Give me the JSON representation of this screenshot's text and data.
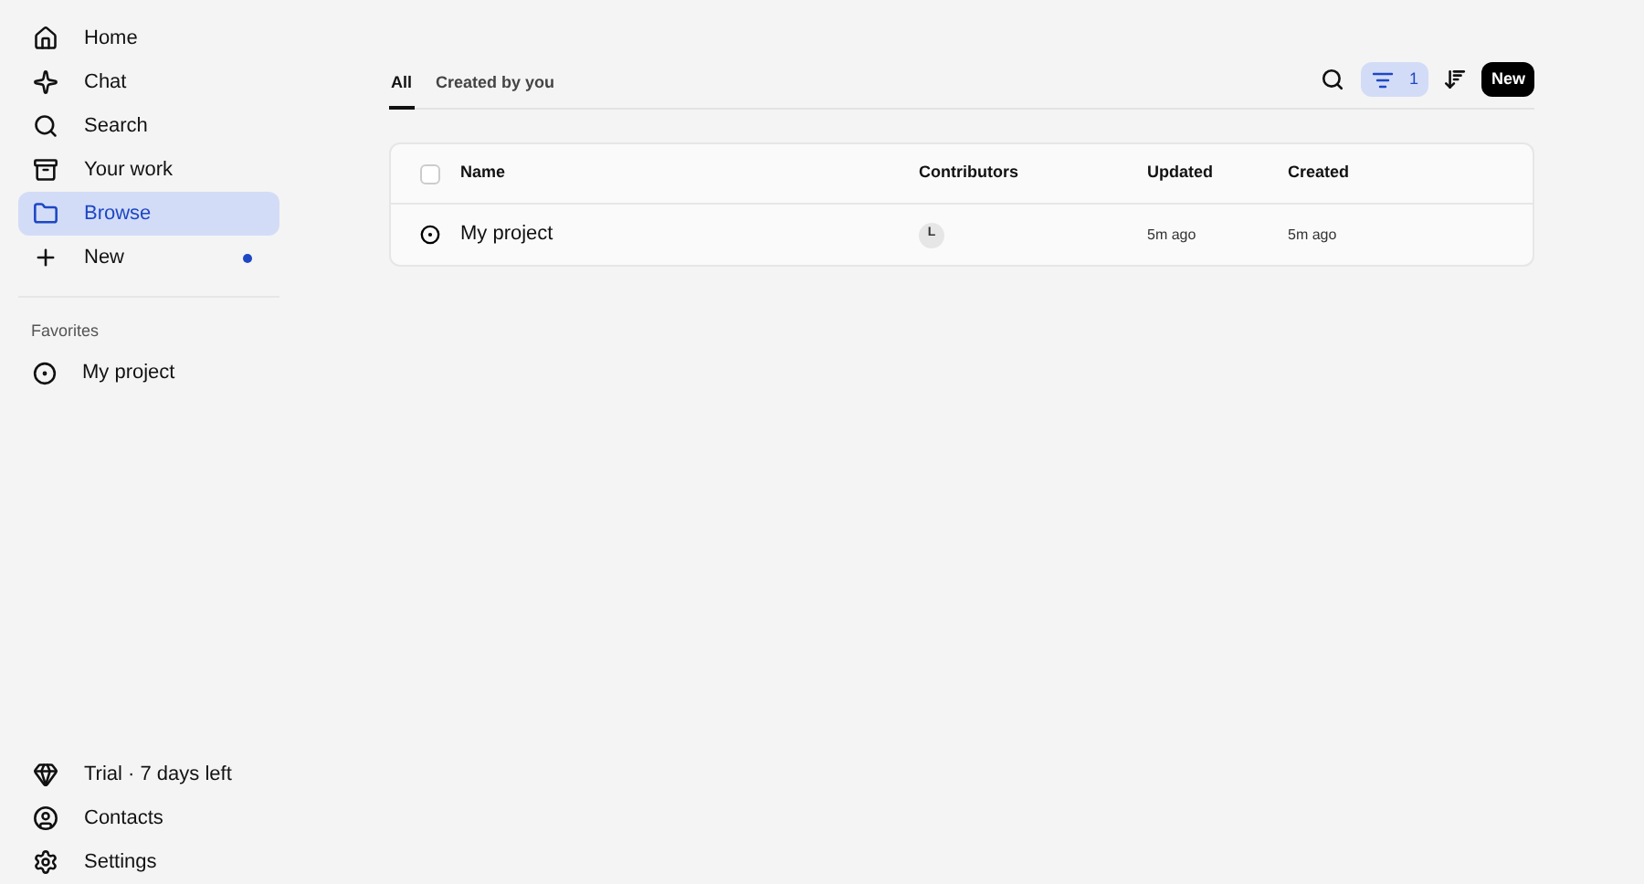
{
  "sidebar": {
    "items": [
      {
        "kind": "home",
        "label": "Home",
        "selected": false,
        "dot": false
      },
      {
        "kind": "chat",
        "label": "Chat",
        "selected": false,
        "dot": false
      },
      {
        "kind": "search",
        "label": "Search",
        "selected": false,
        "dot": false
      },
      {
        "kind": "work",
        "label": "Your work",
        "selected": false,
        "dot": false
      },
      {
        "kind": "browse",
        "label": "Browse",
        "selected": true,
        "dot": false
      },
      {
        "kind": "new",
        "label": "New",
        "selected": false,
        "dot": true
      }
    ],
    "favorites_heading": "Favorites",
    "favorites": [
      {
        "label": "My project",
        "selected": false
      }
    ],
    "bottom_items": [
      {
        "kind": "trial",
        "label": "Trial · 7 days left"
      },
      {
        "kind": "contacts",
        "label": "Contacts"
      },
      {
        "kind": "settings",
        "label": "Settings"
      }
    ]
  },
  "tabs": [
    {
      "label": "All",
      "selected": true
    },
    {
      "label": "Created by you",
      "selected": false
    }
  ],
  "toolbar": {
    "filter_count": "1",
    "new_button": "New"
  },
  "table": {
    "select_all_checked": false,
    "columns": [
      "Name",
      "Contributors",
      "Updated",
      "Created"
    ],
    "rows": [
      {
        "name": "My project",
        "contributor": "L",
        "updated": "5m ago",
        "created": "5m ago"
      }
    ]
  }
}
